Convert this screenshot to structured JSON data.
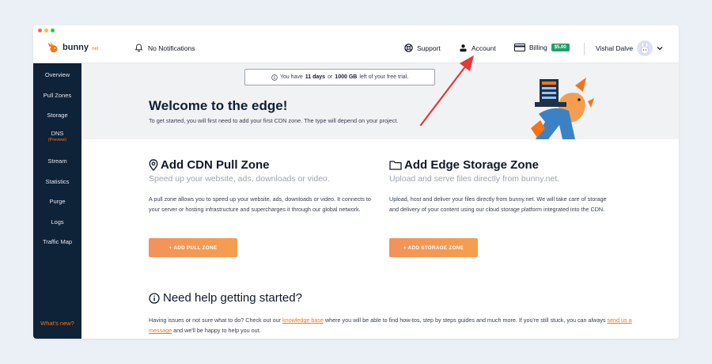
{
  "window_controls": {
    "close_color": "#ff5f57",
    "minimize_color": "#febc2e",
    "maximize_color": "#28c840"
  },
  "brand": {
    "name": "bunny",
    "tld": "net",
    "accent": "#f97316"
  },
  "topbar": {
    "notifications": "No Notifications",
    "support": "Support",
    "account": "Account",
    "billing": "Billing",
    "balance": "$5.00",
    "user": "Vishal Dalve"
  },
  "sidebar": {
    "items": [
      {
        "label": "Overview"
      },
      {
        "label": "Pull Zones"
      },
      {
        "label": "Storage"
      },
      {
        "label": "DNS",
        "sub": "(Preview)"
      },
      {
        "label": "Stream"
      },
      {
        "label": "Statistics"
      },
      {
        "label": "Purge"
      },
      {
        "label": "Logs"
      },
      {
        "label": "Traffic Map"
      }
    ],
    "whats_new": "What's new?"
  },
  "trial": {
    "prefix": "You have",
    "days": "11 days",
    "or": "or",
    "gb": "1000 GB",
    "suffix": "left of your free trial."
  },
  "hero": {
    "title": "Welcome to the edge!",
    "subtitle": "To get started, you will first need to add your first CDN zone. The type will depend on your project."
  },
  "pull_zone": {
    "title": "Add CDN Pull Zone",
    "subtitle": "Speed up your website, ads, downloads or video.",
    "description": "A pull zone allows you to speed up your website, ads, downloads or video. It connects to your server or hosting infrastructure and supercharges it through our global network.",
    "button": "+ ADD PULL ZONE"
  },
  "storage_zone": {
    "title": "Add Edge Storage Zone",
    "subtitle": "Upload and serve files directly from bunny.net.",
    "description": "Upload, host and deliver your files directly from bunny.net. We will take care of storage and delivery of your content using our cloud storage platform integrated into the CDN.",
    "button": "+ ADD STORAGE ZONE"
  },
  "help": {
    "title": "Need help getting started?",
    "text_1": "Having issues or not sure what to do? Check out our",
    "link_1": "knowledge base",
    "text_2": "where you will be able to find how-tos, step by steps guides and much more. If you're still stuck, you can always",
    "link_2": "send us a message",
    "text_3": "and we'll be happy to help you out."
  }
}
